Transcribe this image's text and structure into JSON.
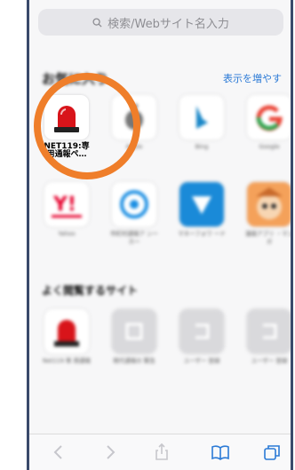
{
  "search": {
    "placeholder": "検索/Webサイト名入力"
  },
  "favorites": {
    "title": "お気に入り",
    "more_label": "表示を増やす",
    "items": [
      {
        "label": "NET119:専用通報ペ…"
      },
      {
        "label": "Apple"
      },
      {
        "label": "Bing"
      },
      {
        "label": "Google"
      },
      {
        "label": "Yahoo"
      },
      {
        "label": "市町村通報ア ンーカー"
      },
      {
        "label": "マネーフォワ ード"
      },
      {
        "label": "漫画アプリ ・マンガ"
      }
    ]
  },
  "frequent": {
    "title": "よく閲覧するサイト",
    "items": [
      {
        "label": "Net119 専 用通報"
      },
      {
        "label": "現代通報の 緊急"
      },
      {
        "label": "ユーザー 登録"
      },
      {
        "label": "ユーザー 登録"
      }
    ]
  },
  "colors": {
    "accent": "#2b7ad6",
    "highlight": "#ef7e2a",
    "siren": "#d8141a"
  }
}
